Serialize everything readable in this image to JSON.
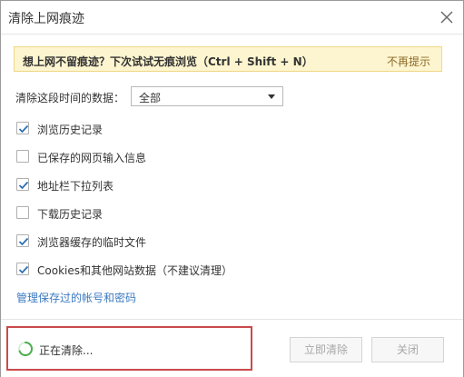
{
  "dialog": {
    "title": "清除上网痕迹"
  },
  "banner": {
    "text": "想上网不留痕迹？下次试试无痕浏览（Ctrl + Shift + N）",
    "dismiss_label": "不再提示"
  },
  "range": {
    "label": "清除这段时间的数据：",
    "selected": "全部"
  },
  "options": [
    {
      "label": "浏览历史记录",
      "checked": true
    },
    {
      "label": "已保存的网页输入信息",
      "checked": false
    },
    {
      "label": "地址栏下拉列表",
      "checked": true
    },
    {
      "label": "下载历史记录",
      "checked": false
    },
    {
      "label": "浏览器缓存的临时文件",
      "checked": true
    },
    {
      "label": "Cookies和其他网站数据（不建议清理）",
      "checked": true
    }
  ],
  "manage_link": "管理保存过的帐号和密码",
  "footer": {
    "status": "正在清除...",
    "clear_label": "立即清除",
    "close_label": "关闭"
  },
  "colors": {
    "accent_check": "#2d6fb5",
    "link": "#3b7ac1",
    "banner_bg": "#fdf5cf",
    "highlight_border": "#c94a4a",
    "spinner": "#4caf50"
  }
}
